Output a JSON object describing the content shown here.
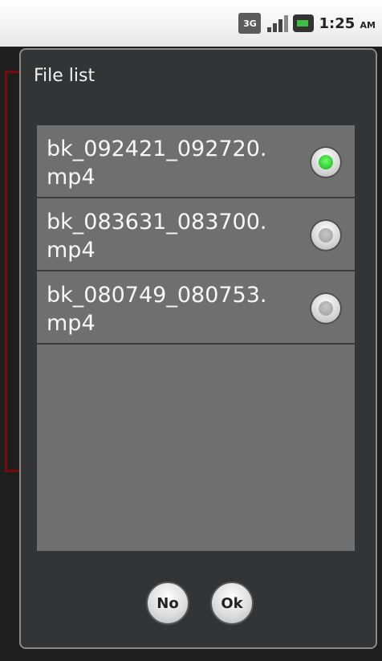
{
  "status_bar": {
    "network": "3G",
    "time": "1:25",
    "ampm": "AM"
  },
  "dialog": {
    "title": "File list",
    "files": [
      {
        "label": "bk_092421_092720.\nmp4",
        "selected": true
      },
      {
        "label": "bk_083631_083700.\nmp4",
        "selected": false
      },
      {
        "label": "bk_080749_080753.\nmp4",
        "selected": false
      }
    ],
    "buttons": {
      "no": "No",
      "ok": "Ok"
    }
  }
}
